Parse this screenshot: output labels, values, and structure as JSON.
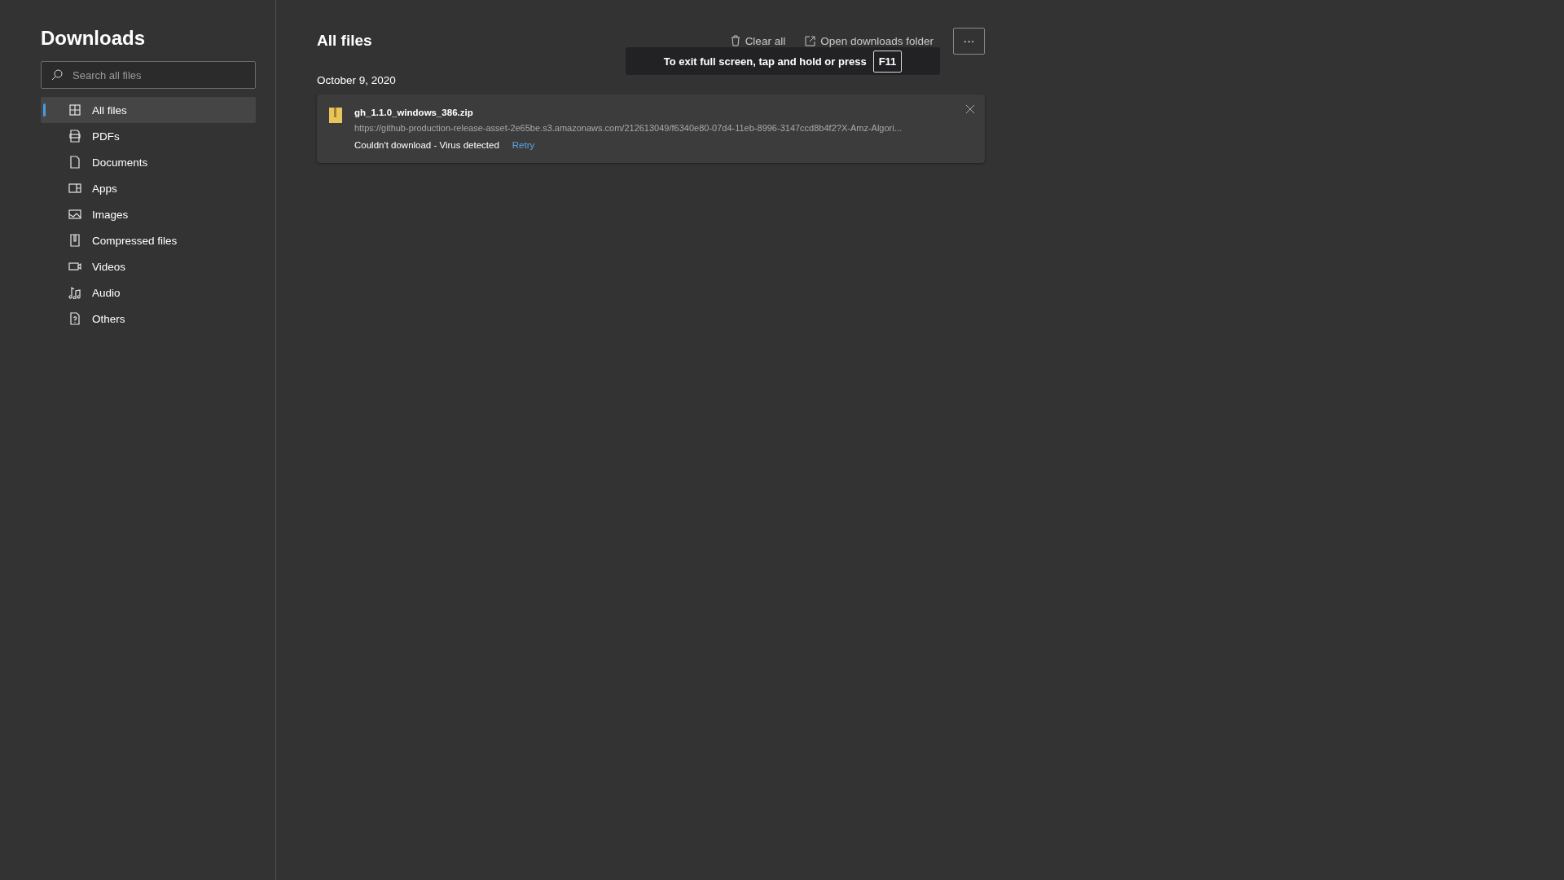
{
  "sidebar": {
    "title": "Downloads",
    "search": {
      "placeholder": "Search all files"
    },
    "items": [
      {
        "label": "All files",
        "kind": "grid",
        "selected": true
      },
      {
        "label": "PDFs",
        "kind": "pdf",
        "selected": false
      },
      {
        "label": "Documents",
        "kind": "doc",
        "selected": false
      },
      {
        "label": "Apps",
        "kind": "apps",
        "selected": false
      },
      {
        "label": "Images",
        "kind": "image",
        "selected": false
      },
      {
        "label": "Compressed files",
        "kind": "zip",
        "selected": false
      },
      {
        "label": "Videos",
        "kind": "video",
        "selected": false
      },
      {
        "label": "Audio",
        "kind": "audio",
        "selected": false
      },
      {
        "label": "Others",
        "kind": "other",
        "selected": false
      }
    ]
  },
  "main": {
    "title": "All files",
    "toolbar": {
      "clear_all": "Clear all",
      "open_folder": "Open downloads folder",
      "more": "···"
    },
    "groups": [
      {
        "date": "October 9, 2020",
        "downloads": [
          {
            "file": "gh_1.1.0_windows_386.zip",
            "url": "https://github-production-release-asset-2e65be.s3.amazonaws.com/212613049/f6340e80-07d4-11eb-8996-3147ccd8b4f2?X-Amz-Algori...",
            "status": "Couldn't download - Virus detected",
            "action": "Retry"
          }
        ]
      }
    ]
  },
  "toast": {
    "text": "To exit full screen, tap and hold or press",
    "key": "F11"
  }
}
